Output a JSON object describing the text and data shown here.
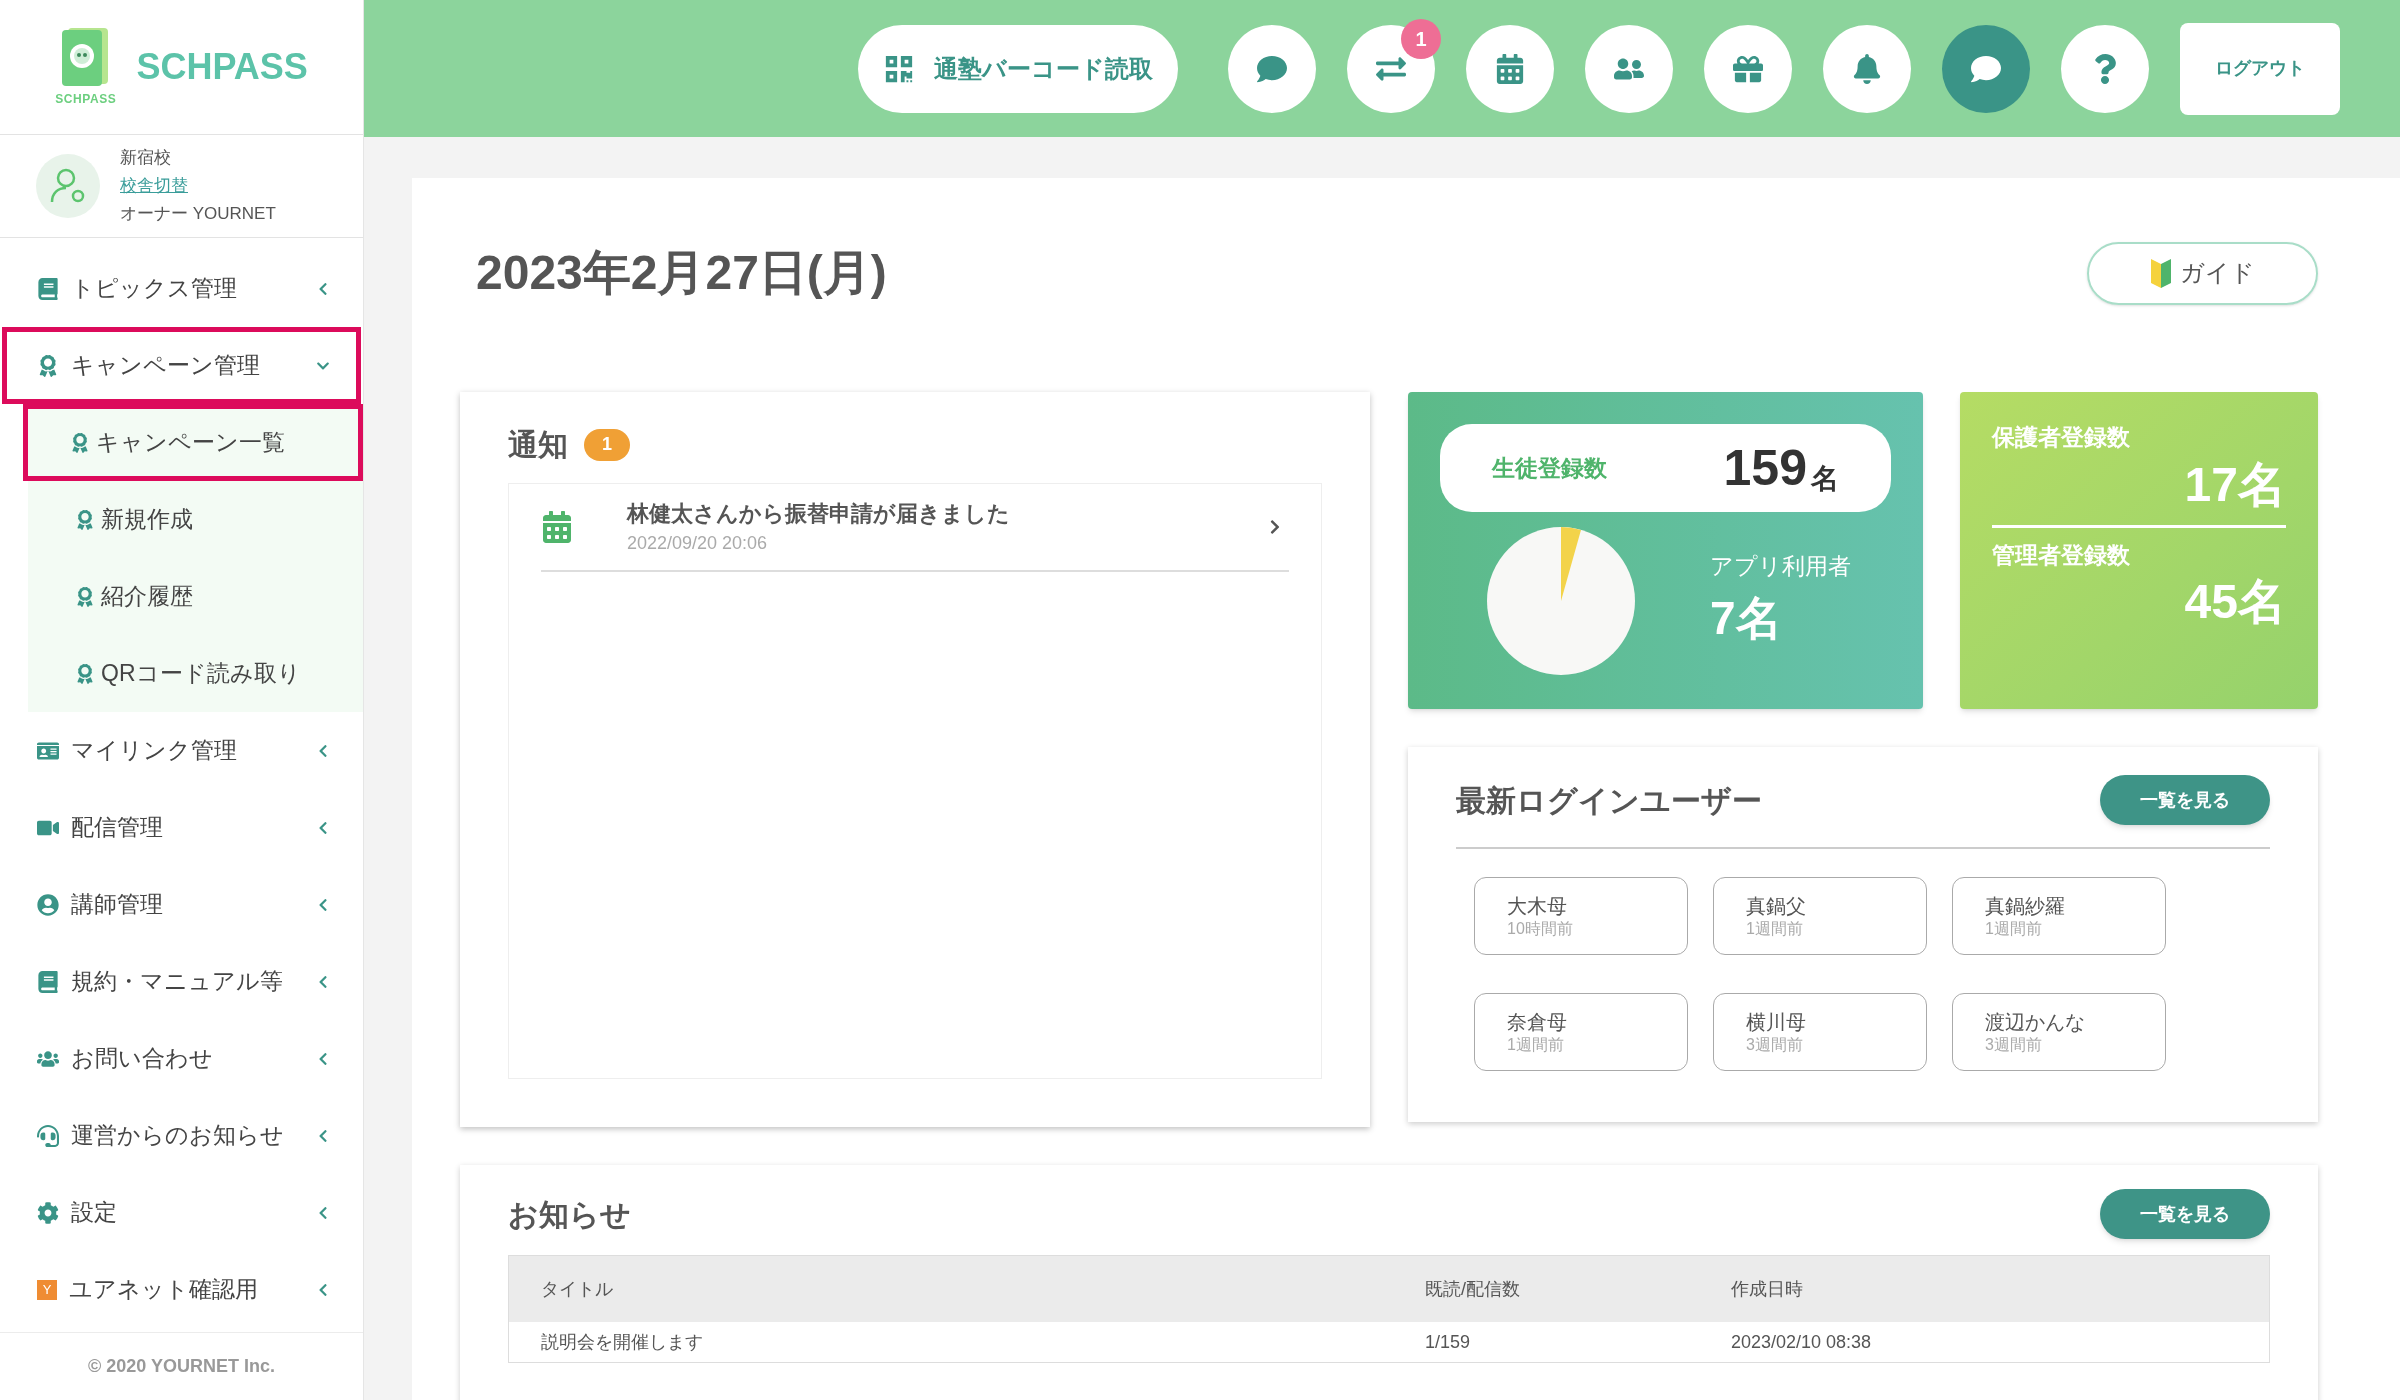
{
  "logo": {
    "name": "SCHPASS",
    "caption": "SCHPASS"
  },
  "profile": {
    "school": "新宿校",
    "switch_link": "校舎切替",
    "user": "オーナー YOURNET"
  },
  "sidebar": {
    "items": [
      {
        "label": "トピックス管理",
        "expanded": false,
        "highlighted": false
      },
      {
        "label": "キャンペーン管理",
        "expanded": true,
        "highlighted": true,
        "children": [
          {
            "label": "キャンペーン一覧",
            "highlighted": true
          },
          {
            "label": "新規作成",
            "highlighted": false
          },
          {
            "label": "紹介履歴",
            "highlighted": false
          },
          {
            "label": "QRコード読み取り",
            "highlighted": false
          }
        ]
      },
      {
        "label": "マイリンク管理",
        "expanded": false,
        "highlighted": false
      },
      {
        "label": "配信管理",
        "expanded": false,
        "highlighted": false
      },
      {
        "label": "講師管理",
        "expanded": false,
        "highlighted": false
      },
      {
        "label": "規約・マニュアル等",
        "expanded": false,
        "highlighted": false
      },
      {
        "label": "お問い合わせ",
        "expanded": false,
        "highlighted": false
      },
      {
        "label": "運営からのお知らせ",
        "expanded": false,
        "highlighted": false
      },
      {
        "label": "設定",
        "expanded": false,
        "highlighted": false
      },
      {
        "label": "ユアネット確認用",
        "expanded": false,
        "highlighted": false,
        "badge": "Y"
      }
    ],
    "footer": "© 2020 YOURNET Inc."
  },
  "header": {
    "barcode_button": "通塾バーコード読取",
    "icon_buttons": [
      {
        "selected": false
      },
      {
        "selected": false,
        "badge": "1"
      },
      {
        "selected": false
      },
      {
        "selected": false
      },
      {
        "selected": false
      },
      {
        "selected": false
      },
      {
        "selected": true
      },
      {
        "selected": false
      }
    ],
    "logout": "ログアウト"
  },
  "page": {
    "date_title": "2023年2月27日(月)",
    "guide_button": "ガイド"
  },
  "notifications": {
    "title": "通知",
    "count": "1",
    "items": [
      {
        "title": "林健太さんから振替申請が届きました",
        "date": "2022/09/20 20:06"
      }
    ]
  },
  "stats": {
    "students_label": "生徒登録数",
    "students_value": "159",
    "students_unit": "名",
    "app_users_label": "アプリ利用者",
    "app_users_value": "7名",
    "guardians_label": "保護者登録数",
    "guardians_value": "17名",
    "admins_label": "管理者登録数",
    "admins_value": "45名"
  },
  "recent_logins": {
    "title": "最新ログインユーザー",
    "view_all": "一覧を見る",
    "users": [
      {
        "name": "大木母",
        "time": "10時間前"
      },
      {
        "name": "真鍋父",
        "time": "1週間前"
      },
      {
        "name": "真鍋紗羅",
        "time": "1週間前"
      },
      {
        "name": "奈倉母",
        "time": "1週間前"
      },
      {
        "name": "横川母",
        "time": "3週間前"
      },
      {
        "name": "渡辺かんな",
        "time": "3週間前"
      }
    ]
  },
  "news": {
    "title": "お知らせ",
    "view_all": "一覧を見る",
    "columns": [
      "タイトル",
      "既読/配信数",
      "作成日時"
    ],
    "rows": [
      [
        "説明会を開催します",
        "1/159",
        "2023/02/10 08:38"
      ]
    ]
  }
}
